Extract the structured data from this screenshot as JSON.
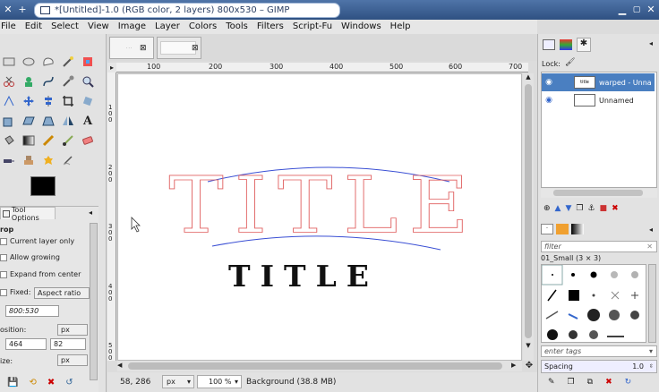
{
  "window": {
    "title": "*[Untitled]-1.0 (RGB color, 2 layers) 800x530 – GIMP"
  },
  "menu": [
    "File",
    "Edit",
    "Select",
    "View",
    "Image",
    "Layer",
    "Colors",
    "Tools",
    "Filters",
    "Script-Fu",
    "Windows",
    "Help"
  ],
  "tool_options": {
    "tab_label": "Tool Options",
    "tool_name": "rop",
    "current_layer_only": "Current layer only",
    "allow_growing": "Allow growing",
    "expand_from_center": "Expand from center",
    "fixed_label": "Fixed:",
    "fixed_value": "Aspect ratio",
    "ratio_value": "800:530",
    "position_label": "osition:",
    "position_unit": "px",
    "position_x": "464",
    "position_y": "82",
    "size_label": "ize:",
    "size_unit": "px"
  },
  "ruler": {
    "h_ticks": [
      "100",
      "200",
      "300",
      "400",
      "500",
      "600",
      "700"
    ],
    "v_ticks": [
      "1\n0\n0",
      "2\n0\n0",
      "3\n0\n0",
      "4\n0\n0",
      "5\n0\n0"
    ]
  },
  "canvas_text": {
    "warped_title": "TITLE",
    "plain_title": "TITLE"
  },
  "status": {
    "coords": "58, 286",
    "unit": "px",
    "zoom": "100 %",
    "layer_info": "Background (38.8 MB)"
  },
  "layers": {
    "lock_label": "Lock:",
    "items": [
      {
        "name": "warped - Unna",
        "thumb_text": "title",
        "selected": true
      },
      {
        "name": "Unnamed",
        "thumb_text": "",
        "selected": false
      }
    ]
  },
  "brushes": {
    "filter_placeholder": "filter",
    "brush_name": "01_Small (3 × 3)",
    "tags_placeholder": "enter tags",
    "spacing_label": "Spacing",
    "spacing_value": "1.0"
  },
  "colors": {
    "titlebar": "#3a5f94",
    "selection": "#4a7fc1",
    "warp_red": "#e06060",
    "warp_blue": "#3a4fd4"
  }
}
